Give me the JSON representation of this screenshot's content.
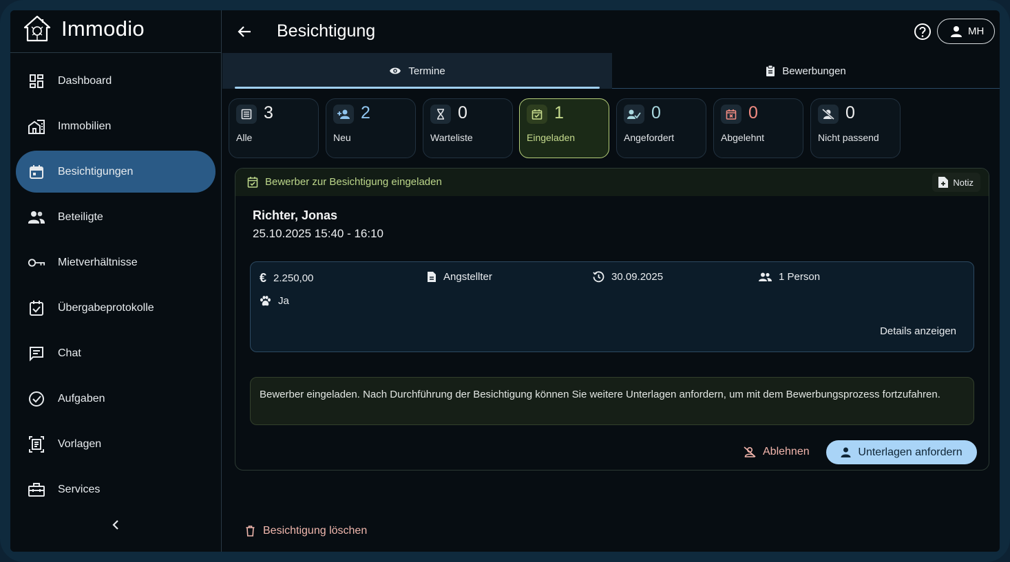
{
  "app": {
    "name": "Immodio"
  },
  "sidebar": {
    "items": [
      {
        "label": "Dashboard",
        "icon": "dashboard-icon"
      },
      {
        "label": "Immobilien",
        "icon": "building-icon"
      },
      {
        "label": "Besichtigungen",
        "icon": "calendar-icon",
        "active": true
      },
      {
        "label": "Beteiligte",
        "icon": "people-icon"
      },
      {
        "label": "Mietverhältnisse",
        "icon": "key-icon"
      },
      {
        "label": "Übergabeprotokolle",
        "icon": "checkbox-calendar-icon"
      },
      {
        "label": "Chat",
        "icon": "chat-icon"
      },
      {
        "label": "Aufgaben",
        "icon": "check-circle-icon"
      },
      {
        "label": "Vorlagen",
        "icon": "template-icon"
      },
      {
        "label": "Services",
        "icon": "toolbox-icon"
      }
    ]
  },
  "header": {
    "title": "Besichtigung",
    "user_initials": "MH"
  },
  "tabs": [
    {
      "label": "Termine",
      "icon": "eye-icon",
      "active": true
    },
    {
      "label": "Bewerbungen",
      "icon": "clipboard-icon"
    }
  ],
  "stats": [
    {
      "count": "3",
      "label": "Alle",
      "icon": "list-icon"
    },
    {
      "count": "2",
      "label": "Neu",
      "icon": "person-add-icon",
      "color": "#8fc4ee"
    },
    {
      "count": "0",
      "label": "Warteliste",
      "icon": "hourglass-icon"
    },
    {
      "count": "1",
      "label": "Eingeladen",
      "icon": "calendar-check-icon",
      "active": true
    },
    {
      "count": "0",
      "label": "Angefordert",
      "icon": "person-check-icon",
      "color": "#a9d8df"
    },
    {
      "count": "0",
      "label": "Abgelehnt",
      "icon": "calendar-x-icon",
      "color": "#f28b82"
    },
    {
      "count": "0",
      "label": "Nicht passend",
      "icon": "person-off-icon"
    }
  ],
  "panel": {
    "heading": "Bewerber zur Besichtigung eingeladen",
    "note_label": "Notiz",
    "applicant_name": "Richter, Jonas",
    "datetime": "25.10.2025 15:40 - 16:10",
    "info": {
      "rent": "2.250,00",
      "occupation": "Angstellter",
      "move_date": "30.09.2025",
      "persons": "1 Person",
      "pets": "Ja"
    },
    "details_label": "Details anzeigen",
    "notice": "Bewerber eingeladen. Nach Durchführung der Besichtigung können Sie weitere Unterlagen anfordern, um mit dem Bewerbungsprozess fortzufahren.",
    "reject_label": "Ablehnen",
    "request_label": "Unterlagen anfordern"
  },
  "delete_label": "Besichtigung löschen",
  "colors": {
    "accent": "#2a5a86",
    "active_green": "#b6cf7a",
    "primary_button": "#a9d4f7",
    "danger_text": "#f0b7ad"
  }
}
